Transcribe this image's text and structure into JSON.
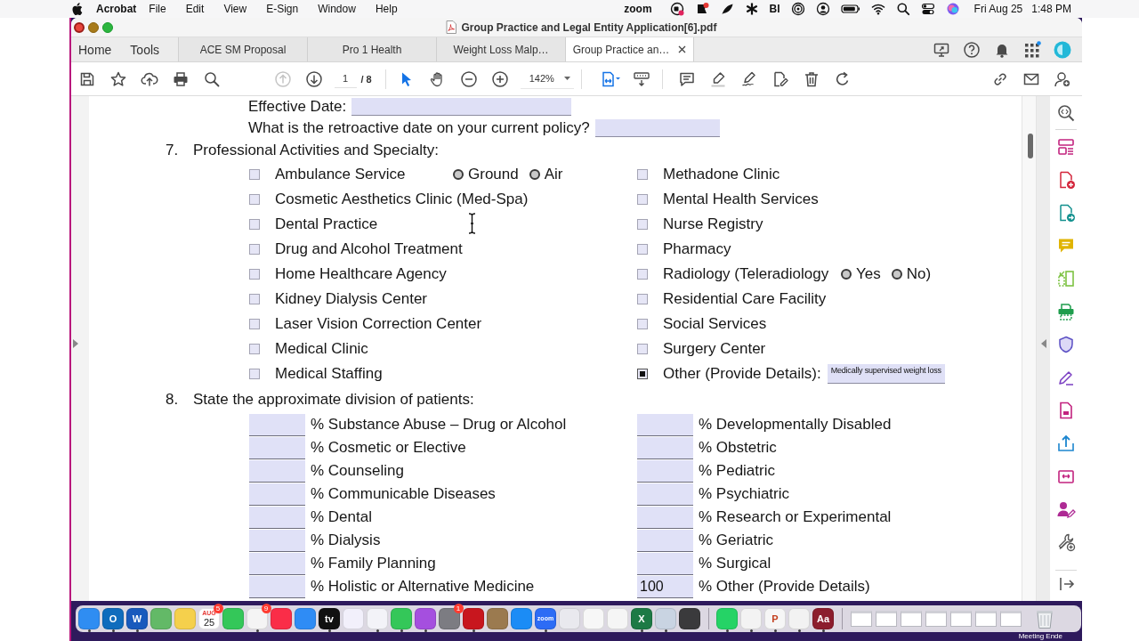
{
  "menu_bar": {
    "app": "Acrobat",
    "menus": [
      "File",
      "Edit",
      "View",
      "E-Sign",
      "Window",
      "Help"
    ],
    "status_logo": "zoom",
    "status_label": "BI",
    "date": "Fri Aug 25",
    "time": "1:48 PM"
  },
  "window": {
    "title": "Group Practice and Legal Entity Application[6].pdf"
  },
  "app_tabs": [
    {
      "label": "Home",
      "selected": false
    },
    {
      "label": "Tools",
      "selected": false
    }
  ],
  "document_tabs": [
    {
      "label": "ACE SM Proposal",
      "selected": false
    },
    {
      "label": "Pro 1 Health",
      "selected": false
    },
    {
      "label": "Weight Loss Malp…",
      "selected": false
    },
    {
      "label": "Group Practice an…",
      "selected": true
    }
  ],
  "toolbar": {
    "page_nav": [
      {
        "kind": "previous",
        "disabled": true
      },
      {
        "kind": "next",
        "disabled": false
      }
    ],
    "page": "1",
    "page_total": "/ 8",
    "tools": [
      {
        "kind": "select",
        "selected": true
      },
      {
        "kind": "hand",
        "selected": false
      }
    ],
    "zoom": "142%"
  },
  "document": {
    "questions": [
      {
        "label": "Effective Date:"
      },
      {
        "label": "What is the retroactive date on your current policy?"
      }
    ],
    "sections": [
      {
        "kind": "checklist",
        "number": "7.",
        "title": "Professional Activities and Specialty:",
        "columns": [
          [
            {
              "label": "Ambulance Service",
              "checked": false,
              "options": [
                {
                  "label": "Ground",
                  "selected": false
                },
                {
                  "label": "Air",
                  "selected": false
                }
              ]
            },
            {
              "label": "Cosmetic Aesthetics Clinic (Med-Spa)",
              "checked": false
            },
            {
              "label": "Dental Practice",
              "checked": false
            },
            {
              "label": "Drug and Alcohol Treatment",
              "checked": false
            },
            {
              "label": "Home Healthcare Agency",
              "checked": false
            },
            {
              "label": "Kidney Dialysis Center",
              "checked": false
            },
            {
              "label": "Laser Vision Correction Center",
              "checked": false
            },
            {
              "label": "Medical Clinic",
              "checked": false
            },
            {
              "label": "Medical Staffing",
              "checked": false
            }
          ],
          [
            {
              "label": "Methadone Clinic",
              "checked": false
            },
            {
              "label": "Mental Health Services",
              "checked": false
            },
            {
              "label": "Nurse Registry",
              "checked": false
            },
            {
              "label": "Pharmacy",
              "checked": false
            },
            {
              "label": "Radiology (Teleradiology",
              "checked": false,
              "options": [
                {
                  "label": "Yes",
                  "selected": false
                },
                {
                  "label": "No)",
                  "selected": false
                }
              ]
            },
            {
              "label": "Residential Care Facility",
              "checked": false
            },
            {
              "label": "Social Services",
              "checked": false
            },
            {
              "label": "Surgery Center",
              "checked": false
            },
            {
              "label": "Other (Provide Details):",
              "checked": true,
              "detail": "Medically supervised weight loss"
            }
          ]
        ]
      },
      {
        "kind": "percentages",
        "number": "8.",
        "title": "State the approximate division of patients:",
        "columns": [
          [
            {
              "label": "% Substance Abuse – Drug or Alcohol"
            },
            {
              "label": "% Cosmetic or Elective"
            },
            {
              "label": "% Counseling"
            },
            {
              "label": "% Communicable Diseases"
            },
            {
              "label": "% Dental"
            },
            {
              "label": "% Dialysis"
            },
            {
              "label": "% Family Planning"
            },
            {
              "label": "% Holistic or Alternative Medicine"
            }
          ],
          [
            {
              "label": "% Developmentally Disabled"
            },
            {
              "label": "% Obstetric"
            },
            {
              "label": "% Pediatric"
            },
            {
              "label": "% Psychiatric"
            },
            {
              "label": "% Research or Experimental"
            },
            {
              "label": "% Geriatric"
            },
            {
              "label": "% Surgical"
            },
            {
              "label": "% Other (Provide Details)",
              "value": "100"
            }
          ]
        ]
      }
    ]
  },
  "dock": {
    "apps": [
      {
        "kind": "tile",
        "color": "#2f8df2",
        "running": true
      },
      {
        "kind": "tile",
        "color": "#0f6cbd",
        "label": "O",
        "running": true
      },
      {
        "kind": "tile",
        "color": "#185abd",
        "label": "W",
        "running": true
      },
      {
        "kind": "tile",
        "color": "#63b967",
        "running": false
      },
      {
        "kind": "tile",
        "color": "#f5d04c",
        "running": false
      },
      {
        "kind": "calendar",
        "color": "#ffffff",
        "month": "AUG",
        "label": "25",
        "badge": "5",
        "running": false
      },
      {
        "kind": "tile",
        "color": "#34c759",
        "running": false
      },
      {
        "kind": "tile",
        "color": "#f4f4f4",
        "badge": "9",
        "running": true
      },
      {
        "kind": "tile",
        "color": "#fa2d48",
        "running": false
      },
      {
        "kind": "tile",
        "color": "#2f8cf5",
        "running": false
      },
      {
        "kind": "tile",
        "color": "#111111",
        "label": "tv",
        "running": true
      },
      {
        "kind": "tile",
        "color": "#f2f0fb",
        "running": false
      },
      {
        "kind": "tile",
        "color": "#f3f3f8",
        "running": true
      },
      {
        "kind": "tile",
        "color": "#34c759",
        "running": true
      },
      {
        "kind": "tile",
        "color": "#a54fdf",
        "running": true
      },
      {
        "kind": "tile",
        "color": "#7c7c82",
        "badge": "1",
        "running": false
      },
      {
        "kind": "tile",
        "color": "#c8161e",
        "running": true
      },
      {
        "kind": "tile",
        "color": "#9b7a4f",
        "running": false
      },
      {
        "kind": "tile",
        "color": "#1b8cf6",
        "running": false
      },
      {
        "kind": "tile",
        "color": "#2d6cf5",
        "label": "zoom",
        "running": true
      },
      {
        "kind": "tile",
        "color": "#e9e9ee",
        "running": false
      },
      {
        "kind": "tile",
        "color": "#f7f7f7",
        "running": false
      },
      {
        "kind": "tile",
        "color": "#f5f5f5",
        "running": false
      },
      {
        "kind": "tile",
        "color": "#1d7a45",
        "label": "X",
        "running": true
      },
      {
        "kind": "tile",
        "color": "#c9d4e2",
        "running": true
      },
      {
        "kind": "tile",
        "color": "#3a3a3c",
        "running": false
      }
    ],
    "recent_apps": [
      {
        "kind": "tile",
        "color": "#25d366",
        "running": true
      },
      {
        "kind": "tile",
        "color": "#f3f3f3",
        "running": true
      },
      {
        "kind": "tile",
        "color": "#f6f6f6",
        "label": "P",
        "running": true
      },
      {
        "kind": "tile",
        "color": "#f2f2f2",
        "running": true
      },
      {
        "kind": "tile",
        "color": "#8c1d2d",
        "label": "Aa",
        "running": true
      }
    ]
  },
  "desktop": {
    "notice": "Meeting Ende"
  }
}
